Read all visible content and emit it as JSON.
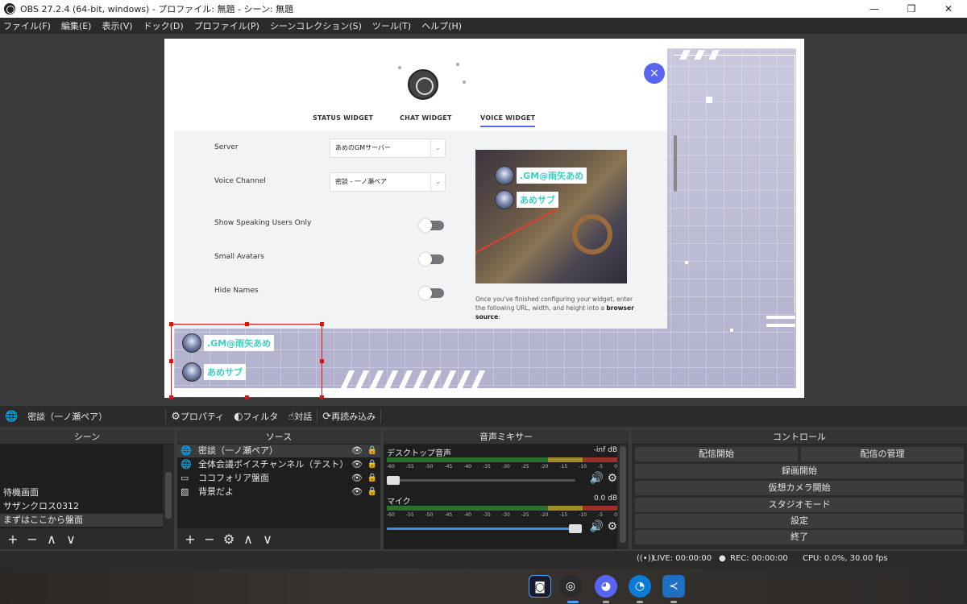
{
  "window": {
    "title": "OBS 27.2.4 (64-bit, windows) - プロファイル: 無題 - シーン: 無題",
    "controls": [
      "—",
      "❐",
      "✕"
    ]
  },
  "menu": [
    "ファイル(F)",
    "編集(E)",
    "表示(V)",
    "ドック(D)",
    "プロファイル(P)",
    "シーンコレクション(S)",
    "ツール(T)",
    "ヘルプ(H)"
  ],
  "widget": {
    "tabs": [
      "STATUS WIDGET",
      "CHAT WIDGET",
      "VOICE WIDGET"
    ],
    "active_tab": "VOICE WIDGET",
    "close": "×",
    "server_label": "Server",
    "server_value": "あめのGMサーバー",
    "channel_label": "Voice Channel",
    "channel_value": "密談 - 一ノ瀬ペア",
    "opt_speaking": "Show Speaking Users Only",
    "opt_small": "Small Avatars",
    "opt_hide": "Hide Names",
    "preview_users": [
      ".GM@雨矢あめ",
      "あめサブ"
    ],
    "note_text": "Once you've finished configuring your widget, enter the following URL, width, and height into a",
    "note_bold": "browser source",
    "note_end": ":"
  },
  "overlay_users": [
    ".GM@雨矢あめ",
    "あめサブ"
  ],
  "source_toolbar": {
    "current_source": "密談（一ノ瀬ペア）",
    "properties": "プロパティ",
    "filters": "フィルタ",
    "interact": "対話",
    "refresh": "再読み込み"
  },
  "scenes": {
    "title": "シーン",
    "items": [
      "待機画面",
      "サザンクロス0312",
      "まずはここから盤面"
    ],
    "selected": "まずはここから盤面"
  },
  "sources": {
    "title": "ソース",
    "items": [
      {
        "name": "密談（一ノ瀬ペア）",
        "icon": "globe-icon"
      },
      {
        "name": "全体会議ボイスチャンネル（テスト）",
        "icon": "globe-icon"
      },
      {
        "name": "ココフォリア盤面",
        "icon": "window-icon"
      },
      {
        "name": "背景だよ",
        "icon": "image-icon"
      }
    ]
  },
  "mixer": {
    "title": "音声ミキサー",
    "channels": [
      {
        "name": "デスクトップ音声",
        "db": "-inf dB",
        "volume": 0.0
      },
      {
        "name": "マイク",
        "db": "0.0 dB",
        "volume": 1.0
      }
    ],
    "scale": [
      "-60",
      "-55",
      "-50",
      "-45",
      "-40",
      "-35",
      "-30",
      "-25",
      "-20",
      "-15",
      "-10",
      "-5",
      "0"
    ]
  },
  "controls": {
    "title": "コントロール",
    "start_stream": "配信開始",
    "manage_stream": "配信の管理",
    "start_record": "録画開始",
    "virtual_cam": "仮想カメラ開始",
    "studio_mode": "スタジオモード",
    "settings": "設定",
    "exit": "終了"
  },
  "status": {
    "live": "LIVE: 00:00:00",
    "rec": "REC: 00:00:00",
    "cpu": "CPU: 0.0%, 30.00 fps"
  },
  "footer_icons": {
    "add": "+",
    "remove": "−",
    "settings": "⚙",
    "up": "∧",
    "down": "∨"
  },
  "colors": {
    "accent": "#5865f2",
    "selection": "#e01010",
    "name_text": "#3ccfc4"
  }
}
